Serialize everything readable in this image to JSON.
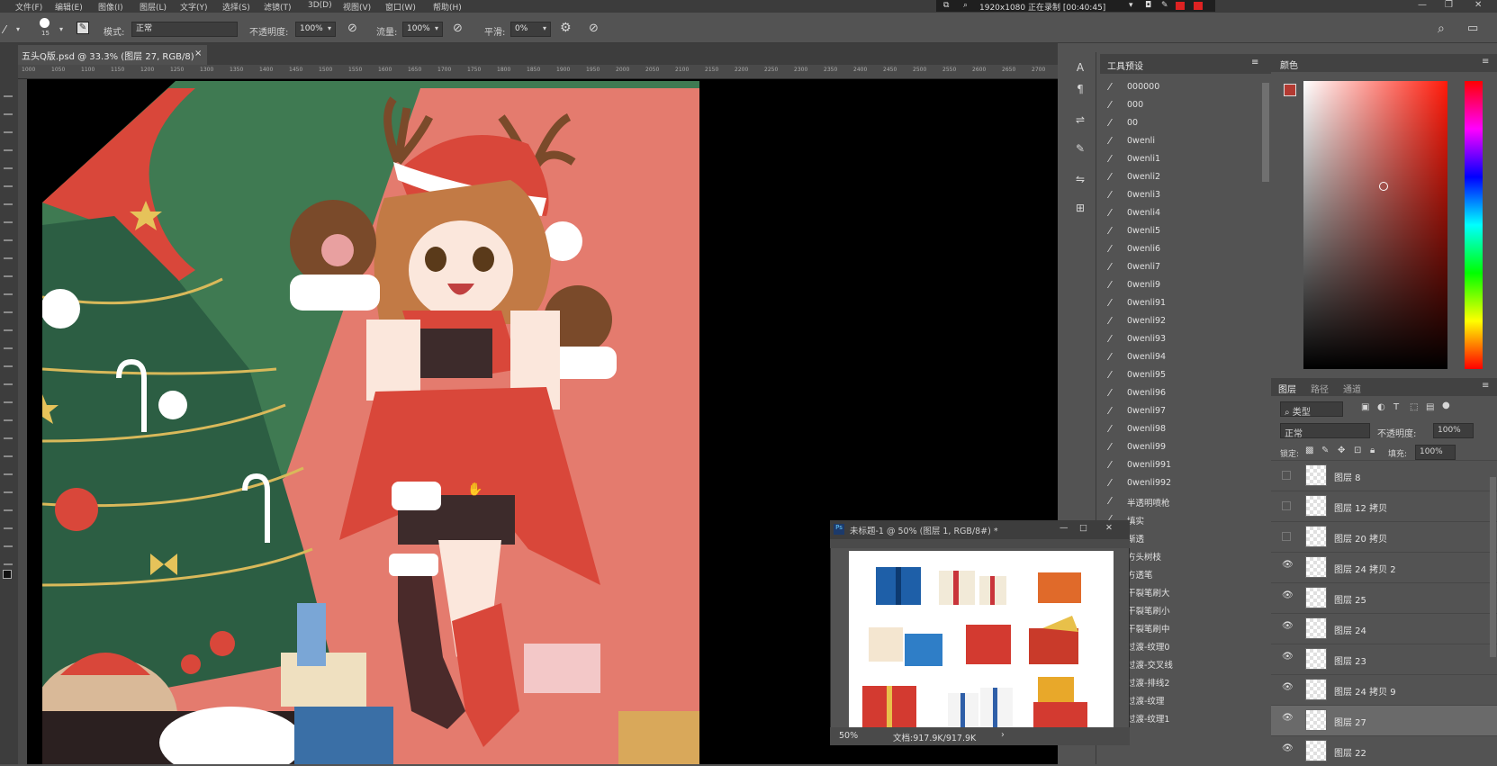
{
  "menubar": {
    "items": [
      "文件(F)",
      "编辑(E)",
      "图像(I)",
      "图层(L)",
      "文字(Y)",
      "选择(S)",
      "滤镜(T)",
      "3D(D)",
      "视图(V)",
      "窗口(W)",
      "帮助(H)"
    ]
  },
  "recording": {
    "text": "1920x1080  正在录制 [00:40:45]"
  },
  "options": {
    "brush_size": "15",
    "mode_label": "模式:",
    "mode_value": "正常",
    "opacity_label": "不透明度:",
    "opacity_value": "100%",
    "flow_label": "流量:",
    "flow_value": "100%",
    "smooth_label": "平滑:",
    "smooth_value": "0%"
  },
  "document": {
    "tab_title": "五头Q版.psd @ 33.3% (图层 27, RGB/8)",
    "ruler_marks": [
      "1000",
      "1050",
      "1100",
      "1150",
      "1200",
      "1250",
      "1300",
      "1350",
      "1400",
      "1450",
      "1500",
      "1550",
      "1600",
      "1650",
      "1700",
      "1750",
      "1800",
      "1850",
      "1900",
      "1950",
      "2000",
      "2050",
      "2100",
      "2150",
      "2200",
      "2250",
      "2300",
      "2350",
      "2400",
      "2450",
      "2500",
      "2550",
      "2600",
      "2650",
      "2700"
    ]
  },
  "presets": {
    "title": "工具预设",
    "items": [
      "000000",
      "000",
      "00",
      "0wenli",
      "0wenli1",
      "0wenli2",
      "0wenli3",
      "0wenli4",
      "0wenli5",
      "0wenli6",
      "0wenli7",
      "0wenli9",
      "0wenli91",
      "0wenli92",
      "0wenli93",
      "0wenli94",
      "0wenli95",
      "0wenli96",
      "0wenli97",
      "0wenli98",
      "0wenli99",
      "0wenli991",
      "0wenli992",
      "半透明喷枪",
      "填实",
      "渐透",
      "方头树枝",
      "方透笔",
      "干裂笔刷大",
      "干裂笔刷小",
      "干裂笔刷中",
      "过渡-纹理0",
      "过渡-交叉线",
      "过渡-排线2",
      "过渡-纹理",
      "过渡-纹理1"
    ]
  },
  "color_panel": {
    "tab": "颜色",
    "fg": "#b33a32",
    "bg": "#111111"
  },
  "layers_panel": {
    "tabs": [
      "图层",
      "路径",
      "通道"
    ],
    "filter_label": "类型",
    "blend": "正常",
    "opacity_label": "不透明度:",
    "opacity_value": "100%",
    "lock_label": "锁定:",
    "fill_label": "填充:",
    "fill_value": "100%",
    "layers": [
      {
        "name": "图层 8",
        "visible": false
      },
      {
        "name": "图层 12 拷贝",
        "visible": false
      },
      {
        "name": "图层 20 拷贝",
        "visible": false
      },
      {
        "name": "图层 24 拷贝 2",
        "visible": true
      },
      {
        "name": "图层 25",
        "visible": true
      },
      {
        "name": "图层 24",
        "visible": true
      },
      {
        "name": "图层 23",
        "visible": true
      },
      {
        "name": "图层 24 拷贝 9",
        "visible": true
      },
      {
        "name": "图层 27",
        "visible": true,
        "selected": true
      },
      {
        "name": "图层 22",
        "visible": true
      }
    ]
  },
  "floating_window": {
    "title": "未标题-1 @ 50% (图层 1, RGB/8#) *",
    "zoom": "50%",
    "doc_info": "文档:917.9K/917.9K"
  }
}
